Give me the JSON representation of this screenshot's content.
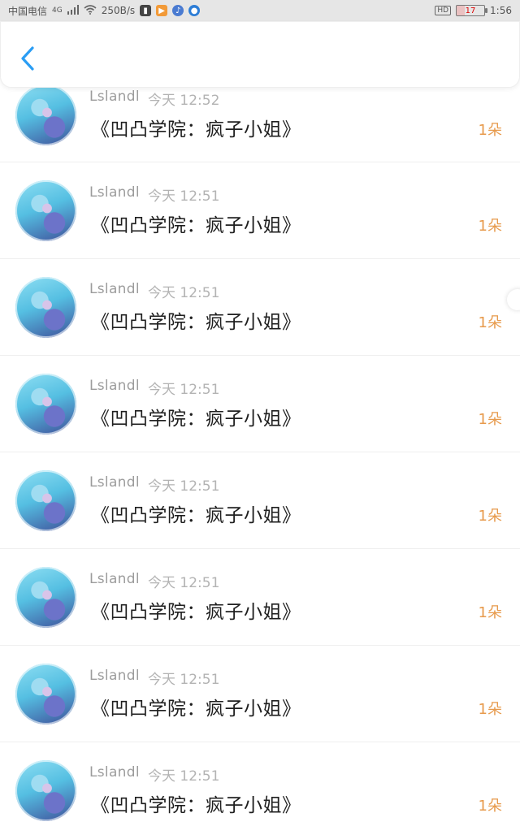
{
  "status_bar": {
    "carrier": "中国电信",
    "network": "4G",
    "speed": "250B/s",
    "hd": "HD",
    "battery_level": "17",
    "time": "1:56"
  },
  "rows": [
    {
      "author": "Lslandl",
      "time": "今天 12:52",
      "title": "《凹凸学院：疯子小姐》",
      "count": "1朵"
    },
    {
      "author": "Lslandl",
      "time": "今天 12:51",
      "title": "《凹凸学院：疯子小姐》",
      "count": "1朵"
    },
    {
      "author": "Lslandl",
      "time": "今天 12:51",
      "title": "《凹凸学院：疯子小姐》",
      "count": "1朵"
    },
    {
      "author": "Lslandl",
      "time": "今天 12:51",
      "title": "《凹凸学院：疯子小姐》",
      "count": "1朵"
    },
    {
      "author": "Lslandl",
      "time": "今天 12:51",
      "title": "《凹凸学院：疯子小姐》",
      "count": "1朵"
    },
    {
      "author": "Lslandl",
      "time": "今天 12:51",
      "title": "《凹凸学院：疯子小姐》",
      "count": "1朵"
    },
    {
      "author": "Lslandl",
      "time": "今天 12:51",
      "title": "《凹凸学院：疯子小姐》",
      "count": "1朵"
    },
    {
      "author": "Lslandl",
      "time": "今天 12:51",
      "title": "《凹凸学院：疯子小姐》",
      "count": "1朵"
    }
  ],
  "colors": {
    "accent_blue": "#2a9df4",
    "count_orange": "#e79a4c"
  }
}
